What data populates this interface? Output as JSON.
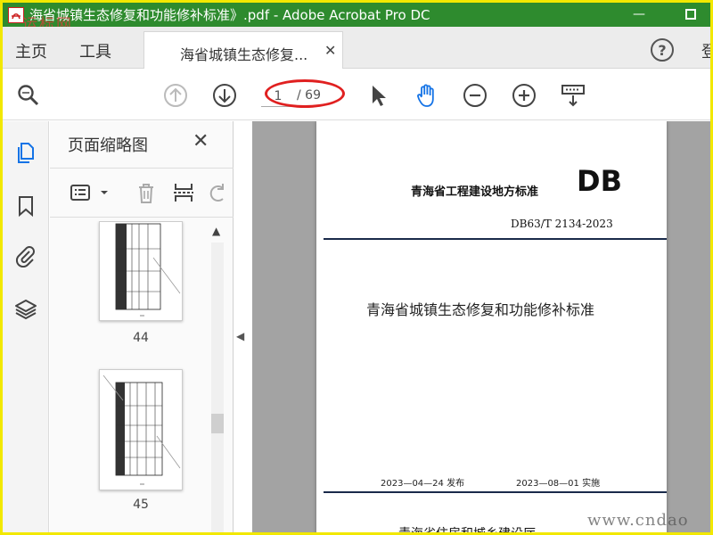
{
  "window": {
    "title": "海省城镇生态修复和功能修补标准》.pdf - Adobe Acrobat Pro DC",
    "watermark_logo": "运标网",
    "watermark_url": "www.cndao",
    "minimize_glyph": "—"
  },
  "tabs": {
    "home": "主页",
    "tools": "工具",
    "document": "海省城镇生态修复...",
    "close_glyph": "✕",
    "signin_partial": "登"
  },
  "toolbar": {
    "page_current": "1",
    "page_total": "/ 69",
    "icons": [
      "search-icon",
      "prev-page-icon",
      "next-page-icon",
      "select-cursor-icon",
      "hand-tool-icon",
      "zoom-out-icon",
      "zoom-in-icon",
      "read-mode-icon"
    ]
  },
  "sidebar": {
    "panel_title": "页面缩略图",
    "panel_close": "✕",
    "icons": [
      "thumbnails-icon",
      "bookmark-icon",
      "attachment-icon",
      "layers-icon"
    ],
    "thumbnails": [
      {
        "label": "44"
      },
      {
        "label": "45"
      }
    ]
  },
  "document": {
    "header": "青海省工程建设地方标准",
    "logo": "DB",
    "standard_number": "DB63/T 2134-2023",
    "title": "青海省城镇生态修复和功能修补标准",
    "issue_date": "2023—04—24 发布",
    "effective_date": "2023—08—01 实施",
    "issuing_org": "青海省住房和城乡建设厅"
  },
  "colors": {
    "titlebar": "#2e8b2e",
    "accent_blue": "#1473e6",
    "annotation_red": "#e02020",
    "border_yellow": "#ffff00"
  }
}
